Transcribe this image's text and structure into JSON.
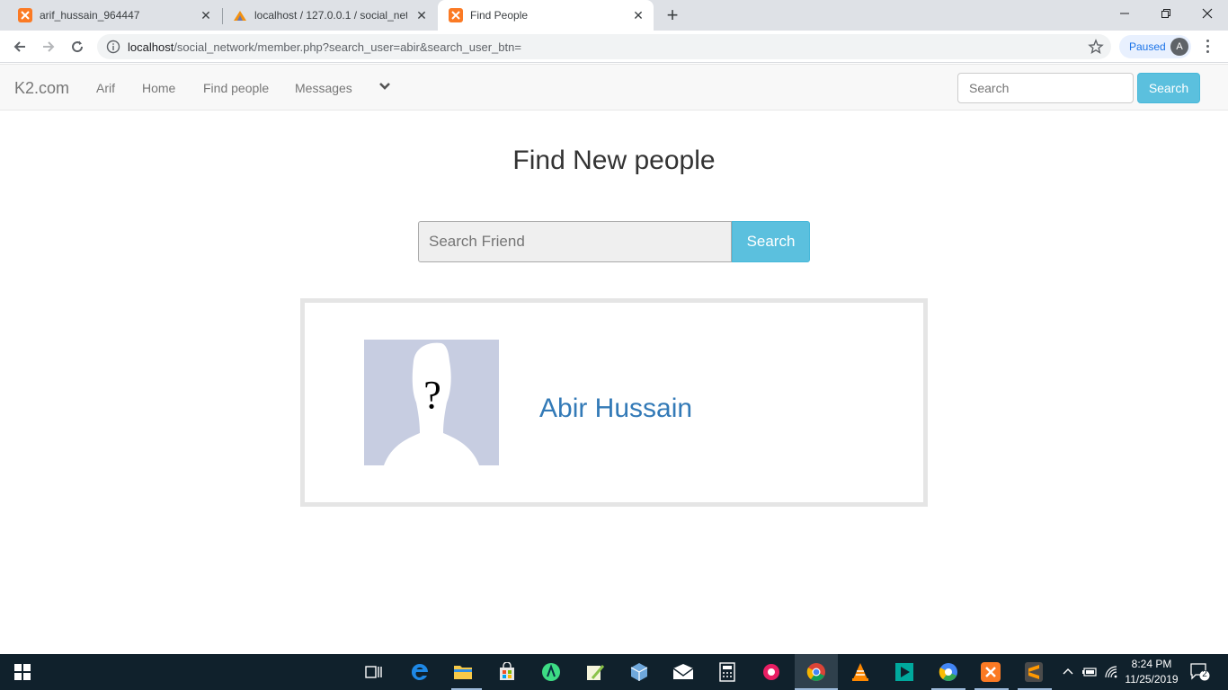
{
  "browser": {
    "tabs": [
      {
        "title": "arif_hussain_964447",
        "icon": "xampp-icon"
      },
      {
        "title": "localhost / 127.0.0.1 / social_netw",
        "icon": "phpmyadmin-icon"
      },
      {
        "title": "Find People",
        "icon": "xampp-icon",
        "active": true
      }
    ],
    "url_host": "localhost",
    "url_path": "/social_network/member.php?search_user=abir&search_user_btn=",
    "profile_status": "Paused",
    "profile_initial": "A"
  },
  "navbar": {
    "brand": "K2.com",
    "links": [
      "Arif",
      "Home",
      "Find people",
      "Messages"
    ],
    "search_placeholder": "Search",
    "search_button": "Search"
  },
  "main": {
    "title": "Find New people",
    "search_placeholder": "Search Friend",
    "search_button": "Search"
  },
  "results": [
    {
      "name": "Abir Hussain",
      "avatar": "default-profile-silhouette"
    }
  ],
  "taskbar": {
    "time": "8:24 PM",
    "date": "11/25/2019",
    "notification_count": "2"
  },
  "colors": {
    "link": "#337ab7",
    "info_button": "#5bc0de",
    "navbar_bg": "#f8f8f8",
    "taskbar_bg": "#10212c"
  }
}
